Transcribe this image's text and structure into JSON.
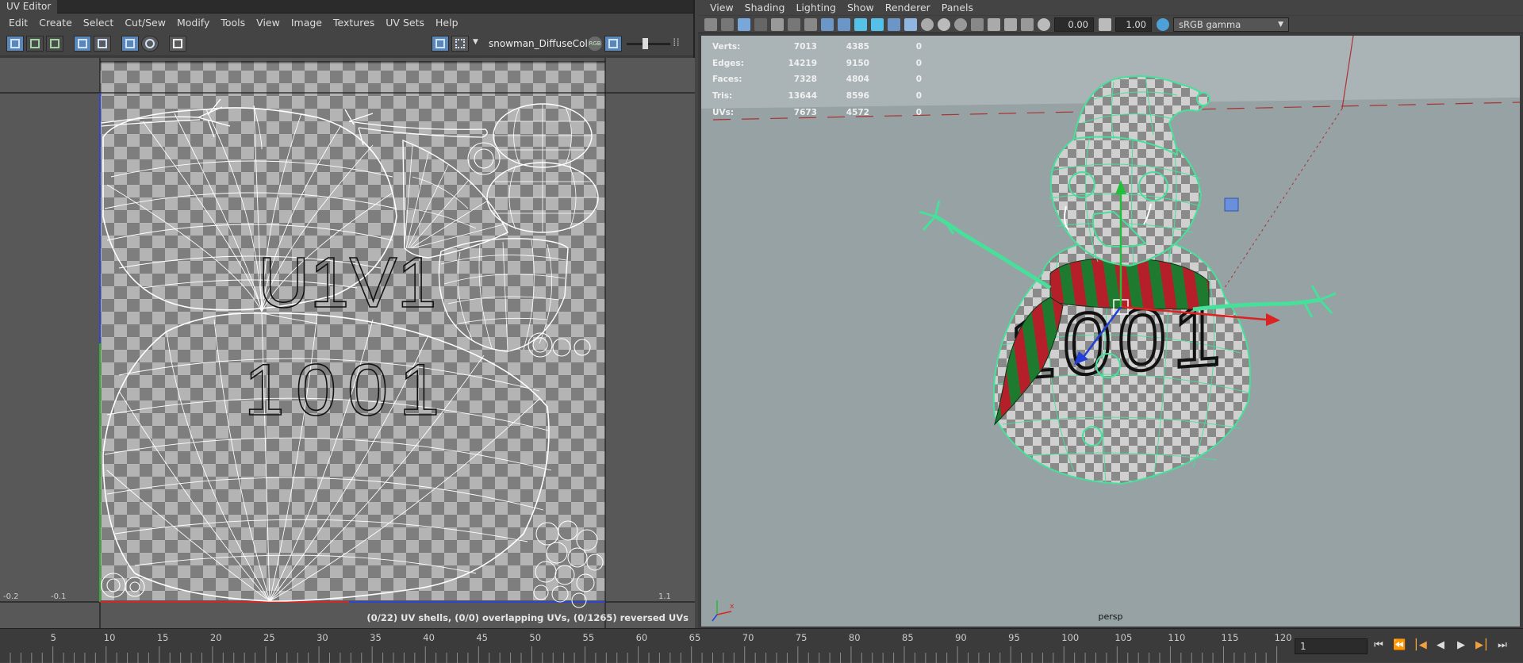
{
  "uv_editor": {
    "title": "UV Editor",
    "menu": [
      "Edit",
      "Create",
      "Select",
      "Cut/Sew",
      "Modify",
      "Tools",
      "View",
      "Image",
      "Textures",
      "UV Sets",
      "Help"
    ],
    "texture_name": "snowman_DiffuseColc",
    "udim_label": "U1V1",
    "udim_number": "1001",
    "axis_labels": {
      "left_min": "-0.2",
      "left_mid": "-0.1",
      "right_tick": "1.1"
    },
    "status": "(0/22) UV shells, (0/0) overlapping UVs, (0/1265) reversed UVs"
  },
  "viewport": {
    "menu": [
      "View",
      "Shading",
      "Lighting",
      "Show",
      "Renderer",
      "Panels"
    ],
    "exposure": "0.00",
    "gamma": "1.00",
    "color_space": "sRGB gamma",
    "camera": "persp",
    "hud": [
      {
        "label": "Verts:",
        "total": "7013",
        "selected": "4385",
        "components": "0"
      },
      {
        "label": "Edges:",
        "total": "14219",
        "selected": "9150",
        "components": "0"
      },
      {
        "label": "Faces:",
        "total": "7328",
        "selected": "4804",
        "components": "0"
      },
      {
        "label": "Tris:",
        "total": "13644",
        "selected": "8596",
        "components": "0"
      },
      {
        "label": "UVs:",
        "total": "7673",
        "selected": "4572",
        "components": "0"
      }
    ],
    "model_text": "1001"
  },
  "timeline": {
    "tick_labels": [
      "5",
      "10",
      "15",
      "20",
      "25",
      "30",
      "35",
      "40",
      "45",
      "50",
      "55",
      "60",
      "65",
      "70",
      "75",
      "80",
      "85",
      "90",
      "95",
      "100",
      "105",
      "110",
      "115",
      "120"
    ],
    "current_frame": "1",
    "controls": [
      "go-start",
      "step-back-key",
      "step-back",
      "play-back",
      "play-forward",
      "step-forward-key",
      "go-end"
    ]
  },
  "colors": {
    "wire": "#ffffff",
    "selected_wire": "#47e09a",
    "scarf_red": "#b51f2a",
    "scarf_green": "#1e7a2f",
    "highlight_button": "#5b86b8"
  }
}
